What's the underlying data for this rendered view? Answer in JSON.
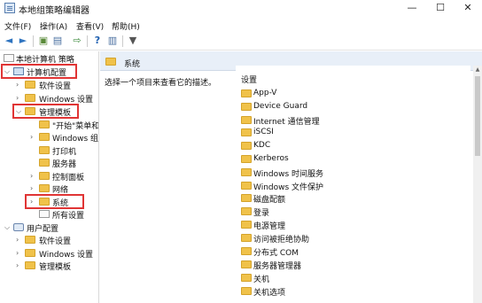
{
  "window": {
    "title": "本地组策略编辑器",
    "minimize": "—",
    "maximize": "☐",
    "close": "✕"
  },
  "menu": [
    "文件(F)",
    "操作(A)",
    "查看(V)",
    "帮助(H)"
  ],
  "toolbar": [
    "◄",
    "►",
    "▣",
    "▤",
    "⇨",
    "?",
    "▥",
    "▼"
  ],
  "tree": {
    "root": "本地计算机 策略",
    "computer_config": "计算机配置",
    "software_settings": "软件设置",
    "windows_settings": "Windows 设置",
    "admin_templates": "管理模板",
    "start_menu": "\"开始\"菜单和",
    "windows_components": "Windows 组",
    "printers": "打印机",
    "server": "服务器",
    "control_panel": "控制面板",
    "network": "网络",
    "system": "系统",
    "all_settings": "所有设置",
    "user_config": "用户配置",
    "user_software_settings": "软件设置",
    "user_windows_settings": "Windows 设置",
    "user_admin_templates": "管理模板"
  },
  "content": {
    "crumb": "系统",
    "description": "选择一个项目来查看它的描述。",
    "list_header": "设置",
    "items": [
      "App-V",
      "Device Guard",
      "Internet 通信管理",
      "iSCSI",
      "KDC",
      "Kerberos",
      "Windows 时间服务",
      "Windows 文件保护",
      "磁盘配额",
      "登录",
      "电源管理",
      "访问被拒绝协助",
      "分布式 COM",
      "服务器管理器",
      "关机",
      "关机选项"
    ]
  },
  "colors": {
    "highlight": "#e03535",
    "folder": "#f0c24a",
    "breadcrumb_bg": "#e8eff8"
  }
}
